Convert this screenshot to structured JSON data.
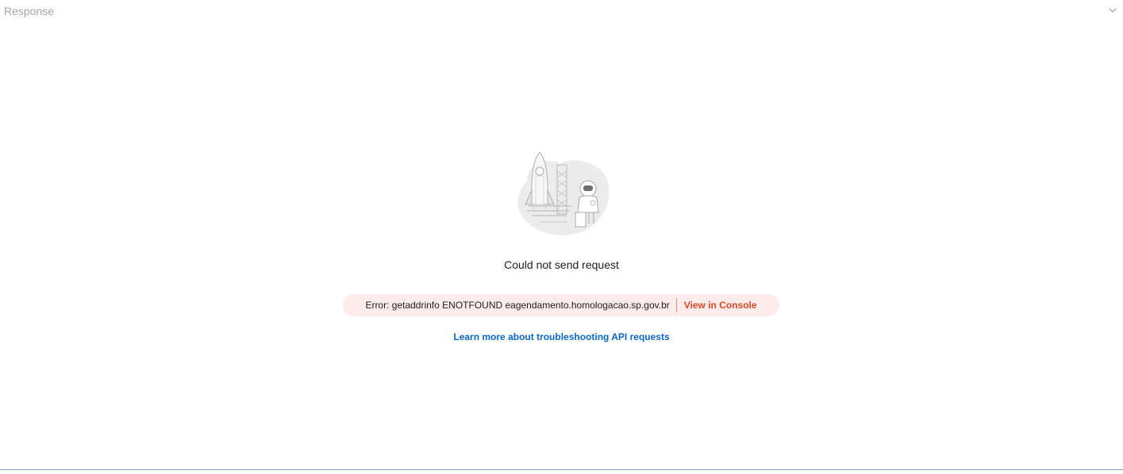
{
  "response_pane": {
    "title": "Response",
    "collapse_icon": "chevron-down-icon"
  },
  "empty_state": {
    "illustration_icon": "rocket-launch-illustration",
    "title": "Could not send request"
  },
  "error": {
    "message": "Error: getaddrinfo ENOTFOUND eagendamento.homologacao.sp.gov.br",
    "console_link_label": "View in Console"
  },
  "help": {
    "link_label": "Learn more about troubleshooting API requests"
  },
  "colors": {
    "error_background": "#fdeceb",
    "console_link": "#d84a23",
    "help_link": "#0b67c4"
  }
}
